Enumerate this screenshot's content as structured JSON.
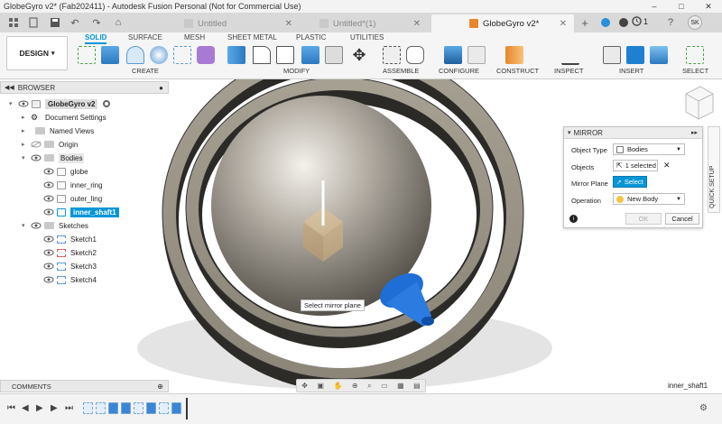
{
  "window": {
    "title": "GlobeGyro v2* (Fab202411) - Autodesk Fusion Personal (Not for Commercial Use)",
    "controls": [
      "–",
      "□",
      "✕"
    ]
  },
  "tabs": [
    {
      "label": "Untitled",
      "active": false
    },
    {
      "label": "Untitled*(1)",
      "active": false
    },
    {
      "label": "GlobeGyro v2*",
      "active": true
    }
  ],
  "topbar": {
    "notification_count": "1",
    "user_initials": "SK"
  },
  "ribbon": {
    "workspace": "DESIGN",
    "tabs": [
      "SOLID",
      "SURFACE",
      "MESH",
      "SHEET METAL",
      "PLASTIC",
      "UTILITIES"
    ],
    "groups": [
      "CREATE",
      "MODIFY",
      "ASSEMBLE",
      "CONFIGURE",
      "CONSTRUCT",
      "INSPECT",
      "INSERT",
      "SELECT"
    ]
  },
  "browser": {
    "title": "BROWSER",
    "items": [
      {
        "label": "GlobeGyro v2",
        "level": 0
      },
      {
        "label": "Document Settings",
        "level": 1
      },
      {
        "label": "Named Views",
        "level": 1
      },
      {
        "label": "Origin",
        "level": 1
      },
      {
        "label": "Bodies",
        "level": 1
      },
      {
        "label": "globe",
        "level": 2
      },
      {
        "label": "inner_ring",
        "level": 2
      },
      {
        "label": "outer_ling",
        "level": 2
      },
      {
        "label": "inner_shaft1",
        "level": 2
      },
      {
        "label": "Sketches",
        "level": 1
      },
      {
        "label": "Sketch1",
        "level": 2
      },
      {
        "label": "Sketch2",
        "level": 2
      },
      {
        "label": "Sketch3",
        "level": 2
      },
      {
        "label": "Sketch4",
        "level": 2
      }
    ]
  },
  "comments": {
    "title": "COMMENTS"
  },
  "viewport": {
    "tooltip": "Select mirror plane",
    "selection_label": "inner_shaft1"
  },
  "mirror_dialog": {
    "title": "MIRROR",
    "object_type_label": "Object Type",
    "object_type_value": "Bodies",
    "objects_label": "Objects",
    "objects_value": "1 selected",
    "mirror_plane_label": "Mirror Plane",
    "mirror_plane_value": "Select",
    "operation_label": "Operation",
    "operation_value": "New Body",
    "ok_label": "OK",
    "cancel_label": "Cancel"
  },
  "quick_setup": "QUICK SETUP",
  "colors": {
    "accent": "#0696d7",
    "selection": "#1e6ed6",
    "ring": "#8a8478"
  }
}
